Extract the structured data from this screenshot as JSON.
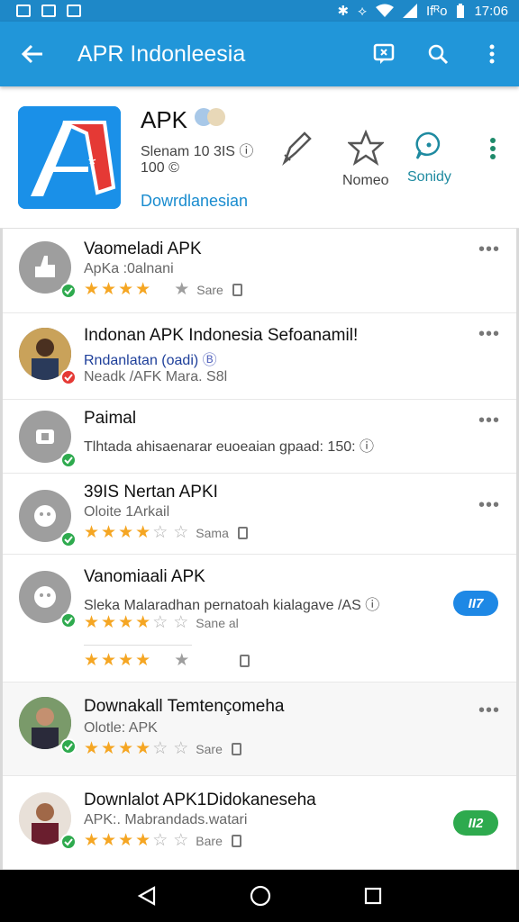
{
  "status_bar": {
    "signal_text": "Ifᴿo",
    "time": "17:06"
  },
  "toolbar": {
    "title": "APR Indonleesia"
  },
  "app": {
    "name": "APK",
    "meta_line1": "Slenam 10 3IS",
    "meta_line2": "100",
    "developer": "Dowrdlanesian",
    "actions": [
      {
        "label": ""
      },
      {
        "label": "Nomeo"
      },
      {
        "label": "Sonidy"
      }
    ]
  },
  "rows": [
    {
      "title": "Vaomeladi APK",
      "subtitle": "ApKa :0alnani",
      "rating": 4,
      "share": "Sare",
      "badge": null
    },
    {
      "title": "Indonan APK Indonesia Sefoanamil!",
      "subtitle": "Rndanlatan (oadi)",
      "subtitle2": "Neadk /AFK Mara. S8l",
      "rating": null,
      "badge": null
    },
    {
      "title": "Paimal",
      "subtitle": "Tlhtada ahisaenarar euoeaian gpaad: 150:",
      "rating": null,
      "badge": null
    },
    {
      "title": "39IS Nertan APKI",
      "subtitle": "Oloite 1Arkail",
      "rating": 4,
      "share": "Sama",
      "badge": null
    },
    {
      "title": "Vanomiaali APK",
      "subtitle": "Sleka Malaradhan pernatoah kialagave /AS",
      "rating": 4,
      "share": "Sane al",
      "badge": "II7"
    },
    {
      "title": "",
      "subtitle": "",
      "rating": 4,
      "badge": null
    },
    {
      "title": "Downakall Temtençomeha",
      "subtitle": "Olotle: APK",
      "rating": 4,
      "share": "Sare",
      "badge": null
    },
    {
      "title": "Downlalot APK1Didokaneseha",
      "subtitle": "APK:. Mabrandads.watari",
      "rating": 4,
      "share": "Bare",
      "badge": "II2"
    }
  ],
  "colors": {
    "primary": "#2196d9",
    "accent_blue": "#1a8ccf",
    "star": "#f5a623",
    "green": "#2eaa4e",
    "pill_blue": "#1e88e5",
    "pill_green": "#2eaa4e"
  }
}
